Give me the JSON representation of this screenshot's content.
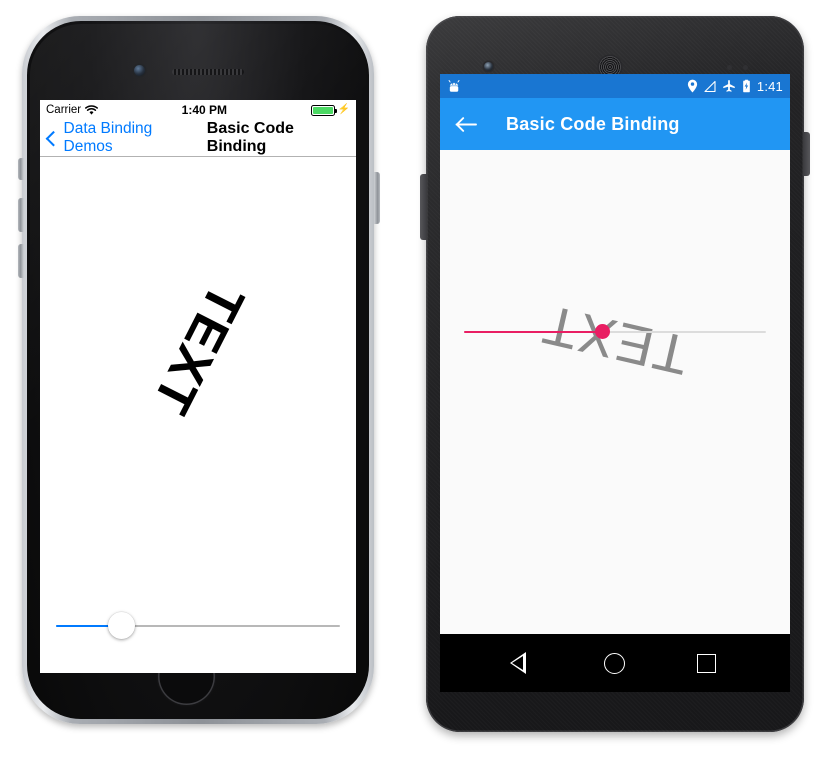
{
  "ios": {
    "status_bar": {
      "carrier": "Carrier",
      "wifi_icon": "wifi-icon",
      "time": "1:40 PM",
      "battery_icon": "battery-full-icon",
      "charging_icon": "charging-bolt-icon"
    },
    "nav_bar": {
      "back_icon": "chevron-left-icon",
      "back_label": "Data Binding Demos",
      "title": "Basic Code Binding"
    },
    "content": {
      "rotated_text": "TEXT",
      "rotation_degrees": 117,
      "text_color": "#000000"
    },
    "slider": {
      "value_percent": 23,
      "min": 0,
      "max": 100,
      "fill_color": "#007aff",
      "track_color": "#b8b8b8",
      "thumb_color": "#ffffff"
    },
    "hardware": {
      "camera": "front-camera",
      "speaker": "earpiece-speaker",
      "home_button": "home-button",
      "power_button": "power-button",
      "volume_buttons": "volume-buttons"
    }
  },
  "android": {
    "status_bar": {
      "robot_icon": "android-robot-icon",
      "location_icon": "location-pin-icon",
      "signal_icon": "signal-off-icon",
      "airplane_icon": "airplane-mode-icon",
      "battery_icon": "battery-charging-icon",
      "time": "1:41",
      "background_color": "#1976d2"
    },
    "app_bar": {
      "back_icon": "arrow-back-icon",
      "title": "Basic Code Binding",
      "background_color": "#2196f3"
    },
    "content": {
      "rotated_text": "TEXT",
      "rotation_degrees": 193,
      "text_color": "#8a8a8a",
      "background_color": "#fafafa"
    },
    "slider": {
      "value_percent": 46,
      "min": 0,
      "max": 100,
      "fill_color": "#e91e63",
      "track_color": "#dcdcdc",
      "thumb_color": "#e91e63"
    },
    "nav_bar": {
      "back_icon": "nav-back-triangle-icon",
      "home_icon": "nav-home-circle-icon",
      "recents_icon": "nav-recents-square-icon",
      "background_color": "#000000"
    },
    "hardware": {
      "camera": "front-camera",
      "speaker": "earpiece-speaker",
      "sensors": "proximity-sensors",
      "power_button": "power-button",
      "volume_buttons": "volume-buttons"
    }
  }
}
